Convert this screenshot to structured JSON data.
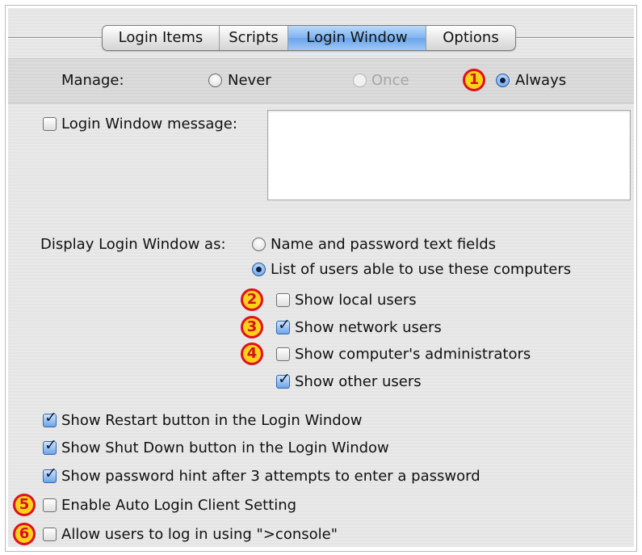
{
  "tabs": [
    {
      "label": "Login Items",
      "selected": false
    },
    {
      "label": "Scripts",
      "selected": false
    },
    {
      "label": "Login Window",
      "selected": true
    },
    {
      "label": "Options",
      "selected": false
    }
  ],
  "manage": {
    "label": "Manage:",
    "options": [
      {
        "label": "Never",
        "selected": false,
        "enabled": true
      },
      {
        "label": "Once",
        "selected": false,
        "enabled": false
      },
      {
        "label": "Always",
        "selected": true,
        "enabled": true
      }
    ]
  },
  "login_message": {
    "label": "Login Window message:",
    "checked": false,
    "value": ""
  },
  "display_as": {
    "label": "Display Login Window as:",
    "options": [
      {
        "label": "Name and password text fields",
        "selected": false
      },
      {
        "label": "List of users able to use these computers",
        "selected": true
      }
    ],
    "sub_options": [
      {
        "label": "Show local users",
        "checked": false
      },
      {
        "label": "Show network users",
        "checked": true
      },
      {
        "label": "Show computer's administrators",
        "checked": false
      },
      {
        "label": "Show other users",
        "checked": true
      }
    ]
  },
  "general_options": [
    {
      "label": "Show Restart button in the Login Window",
      "checked": true
    },
    {
      "label": "Show Shut Down button in the Login Window",
      "checked": true
    },
    {
      "label": "Show password hint after 3 attempts to enter a password",
      "checked": true
    },
    {
      "label": "Enable Auto Login Client Setting",
      "checked": false
    },
    {
      "label": "Allow users to log in using \">console\"",
      "checked": false
    }
  ],
  "callouts": [
    "1",
    "2",
    "3",
    "4",
    "5",
    "6"
  ],
  "colors": {
    "selected_tab": "#7fb3ef",
    "badge_fill": "#ffd21a",
    "badge_ring": "#e0111d"
  }
}
